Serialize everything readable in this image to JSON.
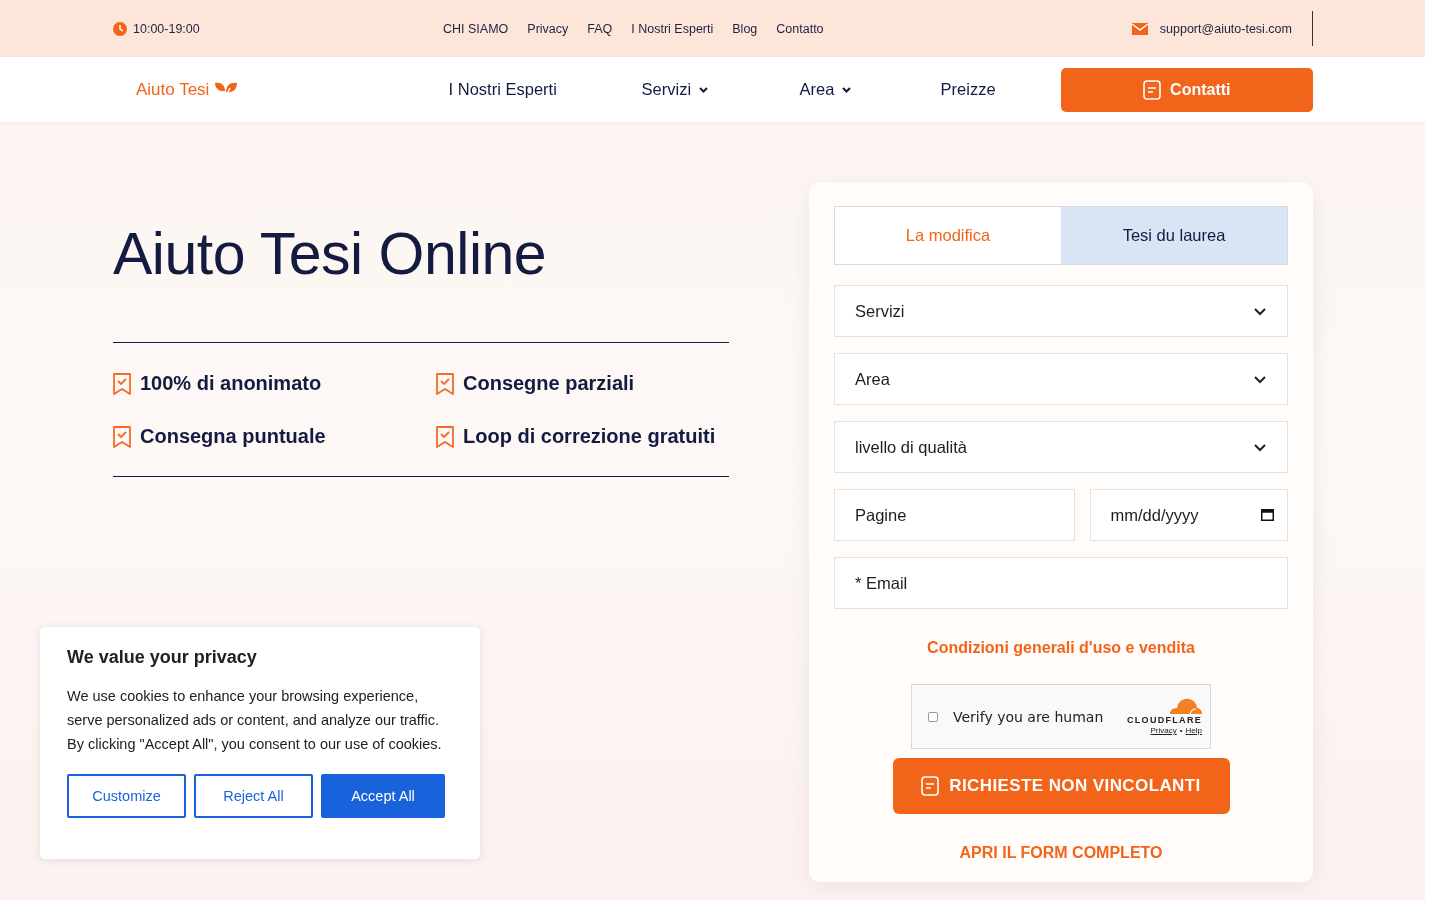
{
  "top_bar": {
    "hours": "10:00-19:00",
    "links": [
      "CHI SIAMO",
      "Privacy",
      "FAQ",
      "I Nostri Esperti",
      "Blog",
      "Contatto"
    ],
    "email": "support@aiuto-tesi.com"
  },
  "nav": {
    "logo": "Aiuto Tesi",
    "items": [
      {
        "label": "I Nostri Esperti",
        "dropdown": false
      },
      {
        "label": "Servizi",
        "dropdown": true
      },
      {
        "label": "Area",
        "dropdown": true
      },
      {
        "label": "Preizze",
        "dropdown": false
      }
    ],
    "cta": "Contatti"
  },
  "hero": {
    "title": "Aiuto Tesi Online",
    "features": [
      "100% di anonimato",
      "Consegne parziali",
      "Consegna puntuale",
      "Loop di correzione gratuiti"
    ]
  },
  "form": {
    "tabs": [
      {
        "label": "La modifica",
        "selected": false
      },
      {
        "label": "Tesi du laurea",
        "selected": true
      }
    ],
    "selects": [
      "Servizi",
      "Area",
      "livello di qualità"
    ],
    "pages": {
      "placeholder": "Pagine"
    },
    "date": {
      "placeholder": "mm/dd/yyyy"
    },
    "email": {
      "placeholder": "* Email"
    },
    "terms_link": "Condizioni generali d'uso e vendita",
    "captcha": {
      "checked": false,
      "label": "Verify you are human",
      "brand": "CLOUDFLARE",
      "privacy": "Privacy",
      "separator": "•",
      "help": "Help"
    },
    "submit": "RICHIESTE NON VINCOLANTI",
    "full_form": "APRI IL FORM COMPLETO"
  },
  "cookie": {
    "title": "We value your privacy",
    "text": "We use cookies to enhance your browsing experience, serve personalized ads or content, and analyze our traffic. By clicking \"Accept All\", you consent to our use of cookies.",
    "buttons": [
      {
        "label": "Customize",
        "kind": "outline"
      },
      {
        "label": "Reject All",
        "kind": "outline"
      },
      {
        "label": "Accept All",
        "kind": "primary"
      }
    ]
  }
}
